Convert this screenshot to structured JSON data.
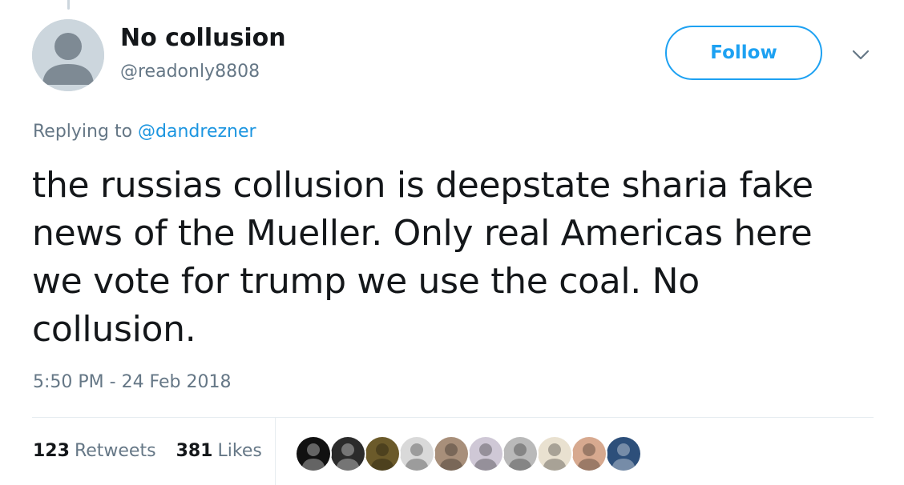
{
  "tweet": {
    "author": {
      "name": "No collusion",
      "handle": "@readonly8808"
    },
    "follow_label": "Follow",
    "menu_icon": "chevron-down-icon",
    "reply": {
      "prefix": "Replying to",
      "mention": "@dandrezner"
    },
    "text_lines": [
      "the russias collusion is deepstate sharia fake",
      "news of the Mueller. Only real Americas here",
      "we vote for trump we use the coal. No",
      "collusion."
    ],
    "timestamp": "5:50 PM - 24 Feb 2018",
    "stats": {
      "retweets_count": "123",
      "retweets_label": "Retweets",
      "likes_count": "381",
      "likes_label": "Likes"
    },
    "liker_avatar_colors": [
      "#111111",
      "#2b2b2b",
      "#6b5a2a",
      "#d9d9d9",
      "#a88f7a",
      "#cfc8d6",
      "#b9b9b9",
      "#e9e1d0",
      "#d7a98f",
      "#2d4f7a"
    ]
  },
  "colors": {
    "accent": "#1da1f2",
    "text": "#14171a",
    "muted": "#657786",
    "divider": "#e6ecf0"
  }
}
